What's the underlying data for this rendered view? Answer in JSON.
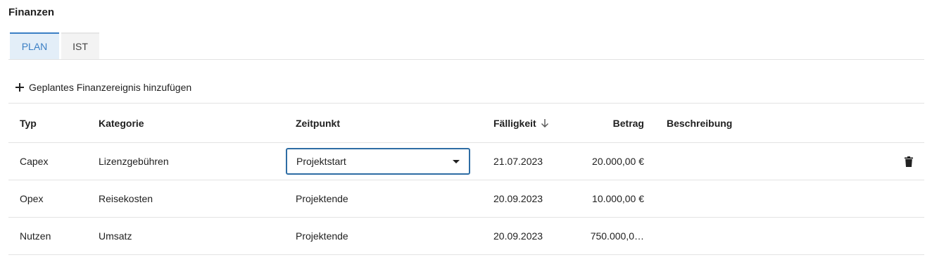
{
  "section": {
    "title": "Finanzen"
  },
  "tabs": [
    {
      "label": "PLAN",
      "active": true
    },
    {
      "label": "IST",
      "active": false
    }
  ],
  "add_button": {
    "label": "Geplantes Finanzereignis hinzufügen",
    "icon": "plus-icon"
  },
  "table": {
    "columns": {
      "typ": "Typ",
      "kategorie": "Kategorie",
      "zeitpunkt": "Zeitpunkt",
      "faelligkeit": "Fälligkeit",
      "betrag": "Betrag",
      "beschreibung": "Beschreibung"
    },
    "sort": {
      "column": "faelligkeit",
      "direction": "ascending",
      "icon": "arrow-down-icon"
    },
    "rows": [
      {
        "typ": "Capex",
        "kategorie": "Lizenzgebühren",
        "zeitpunkt": "Projektstart",
        "faelligkeit": "21.07.2023",
        "betrag": "20.000,00 €",
        "beschreibung": "",
        "editing": true
      },
      {
        "typ": "Opex",
        "kategorie": "Reisekosten",
        "zeitpunkt": "Projektende",
        "faelligkeit": "20.09.2023",
        "betrag": "10.000,00 €",
        "beschreibung": ""
      },
      {
        "typ": "Nutzen",
        "kategorie": "Umsatz",
        "zeitpunkt": "Projektende",
        "faelligkeit": "20.09.2023",
        "betrag": "750.000,0…",
        "beschreibung": ""
      }
    ]
  },
  "colors": {
    "accent": "#3b7fc4",
    "tab_active_bg": "#e3eef8",
    "select_border": "#2e6da4",
    "divider": "#e3e3e3"
  }
}
